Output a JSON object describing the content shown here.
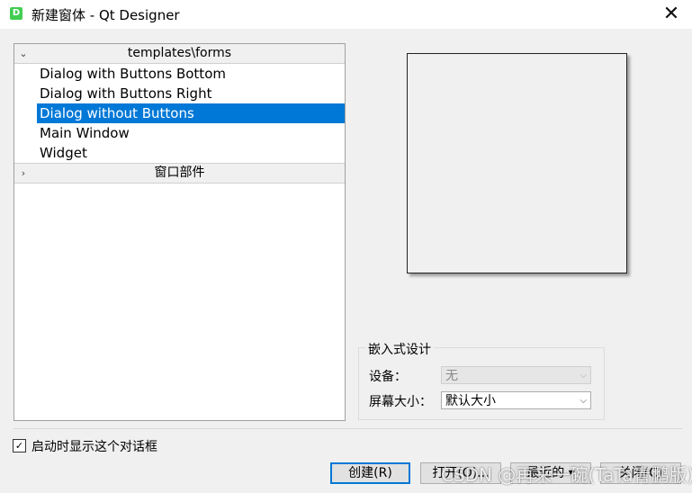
{
  "window": {
    "icon_letter": "D",
    "title": "新建窗体 - Qt Designer",
    "close_glyph": "✕"
  },
  "tree": {
    "category_expanded": {
      "arrow": "⌄",
      "label": "templates\\forms"
    },
    "items": [
      "Dialog with Buttons Bottom",
      "Dialog with Buttons Right",
      "Dialog without Buttons",
      "Main Window",
      "Widget"
    ],
    "selected_index": 2,
    "category_collapsed": {
      "arrow": "›",
      "label": "窗口部件"
    }
  },
  "embedded": {
    "group_title": "嵌入式设计",
    "device_label": "设备：",
    "device_value": "无",
    "screen_label": "屏幕大小：",
    "screen_value": "默认大小"
  },
  "startup_checkbox": {
    "checked": true,
    "label": "启动时显示这个对话框"
  },
  "buttons": {
    "create": "创建(R)",
    "open": "打开(O)...",
    "recent": "最近的",
    "close": "关闭(C)"
  },
  "watermark": "CSDN @再来一碗(TaTa青鹏版)"
}
